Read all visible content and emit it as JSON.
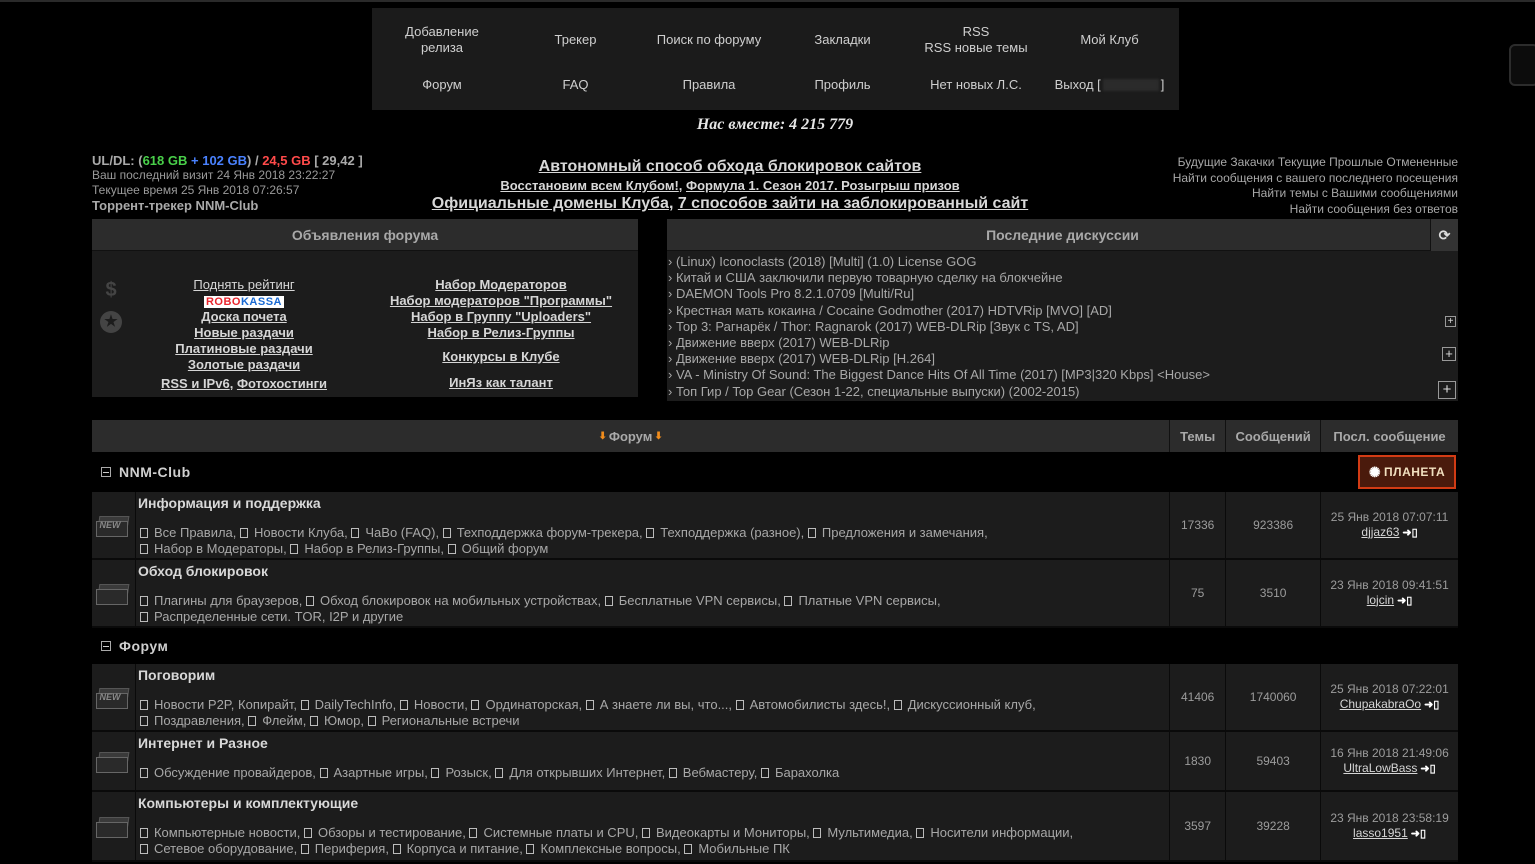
{
  "nav": {
    "row1": [
      "Добавление релиза",
      "Трекер",
      "Поиск по форуму",
      "Закладки",
      "RSS",
      "Мой Клуб"
    ],
    "rss_sub": "RSS новые темы",
    "row2": [
      "Форум",
      "FAQ",
      "Правила",
      "Профиль",
      "Нет новых Л.С.",
      "Выход ["
    ],
    "logout_close": "]"
  },
  "together": "Нас вместе: 4 215 779",
  "user": {
    "uldl_label": "UL/DL:",
    "open_paren": "(",
    "ul": "618 GB",
    "plus": " + ",
    "bonus": "102 GB",
    "slash": ") / ",
    "dl": "24,5 GB",
    "ratio": " [ 29,42 ]",
    "last_visit": "Ваш последний визит 24 Янв 2018 23:22:27",
    "current_time": "Текущее время 25 Янв 2018 07:26:57",
    "tracker_name": "Торрент-трекер NNM-Club"
  },
  "center": {
    "line1": "Автономный способ обхода блокировок сайтов",
    "line2a": "Восстановим всем Клубом!",
    "line2b": "Формула 1. Сезон 2017. Розыгрыш призов",
    "line3a": "Официальные домены Клуба",
    "line3b": "7 способов зайти на заблокированный сайт",
    "comma": ", "
  },
  "right_links": {
    "future": "Будущие Закачки",
    "current": "Текущие",
    "past": "Прошлые",
    "cancelled": "Отмененные",
    "since_last": "Найти сообщения с вашего последнего посещения",
    "your_topics": "Найти темы с Вашими сообщениями",
    "unanswered": "Найти сообщения без ответов"
  },
  "announcements": {
    "title": "Объявления форума",
    "left": {
      "raise_rating": "Поднять рейтинг",
      "robokassa_a": "ROBO",
      "robokassa_b": "KASSA",
      "honor": "Доска почета",
      "new": "Новые раздачи",
      "platinum": "Платиновые раздачи",
      "gold": "Золотые раздачи",
      "rss": "RSS и IPv6",
      "photohost": "Фотохостинги",
      "comma": ", "
    },
    "right": [
      "Набор Модераторов",
      "Набор модераторов \"Программы\"",
      "Набор в Группу \"Uploaders\"",
      "Набор в Релиз-Группы",
      "Конкурсы в Клубе",
      "ИнЯз как талант"
    ],
    "icons": [
      "$",
      "★"
    ]
  },
  "discussions": {
    "title": "Последние дискуссии",
    "items": [
      "› (Linux) Iconoclasts (2018) [Multi] (1.0) License GOG",
      "› Китай и США заключили первую товарную сделку на блокчейне",
      "› DAEMON Tools Pro 8.2.1.0709 [Multi/Ru]",
      "› Крестная мать кокаина / Cocaine Godmother (2017) HDTVRip [MVO] [AD]",
      "› Тор 3: Рагнарёк / Thor: Ragnarok (2017) WEB-DLRip [Звук с TS, AD]",
      "› Движение вверх (2017) WEB-DLRip",
      "› Движение вверх (2017) WEB-DLRip [H.264]",
      "› VA - Ministry Of Sound: The Biggest Dance Hits Of All Time (2017) [MP3|320 Kbps] <House>",
      "› Топ Гир / Top Gear (Сезон 1-22, специальные выпуски) (2002-2015)"
    ],
    "refresh_icon": "⟳",
    "plus": "+"
  },
  "table": {
    "headers": {
      "forum": "Форум",
      "topics": "Темы",
      "messages": "Сообщений",
      "last": "Посл. сообщение"
    },
    "arrow": "⬇",
    "banner": "ПЛАНЕТА",
    "categories": [
      "NNM-Club",
      "Форум"
    ],
    "rows": [
      {
        "title": "Информация и поддержка",
        "new": "NEW",
        "subs": [
          "Все Правила",
          "Новости Клуба",
          "ЧаВо (FAQ)",
          "Техподдержка форум-трекера",
          "Техподдержка (разное)",
          "Предложения и замечания",
          "Набор в Модераторы",
          "Набор в Релиз-Группы",
          "Общий форум"
        ],
        "topics": "17336",
        "messages": "923386",
        "date": "25 Янв 2018 07:07:11",
        "user": "djjaz63"
      },
      {
        "title": "Обход блокировок",
        "subs": [
          "Плагины для браузеров",
          "Обход блокировок на мобильных устройствах",
          "Бесплатные VPN сервисы",
          "Платные VPN сервисы",
          "Распределенные сети. TOR, I2P и другие"
        ],
        "topics": "75",
        "messages": "3510",
        "date": "23 Янв 2018 09:41:51",
        "user": "lojcin"
      },
      {
        "title": "Поговорим",
        "new": "NEW",
        "subs": [
          "Новости P2P, Копирайт",
          "DailyTechInfo",
          "Новости",
          "Ординаторская",
          "А знаете ли вы, что...",
          "Автомобилисты здесь!",
          "Дискуссионный клуб",
          "Поздравления",
          "Флейм",
          "Юмор",
          "Региональные встречи"
        ],
        "topics": "41406",
        "messages": "1740060",
        "date": "25 Янв 2018 07:22:01",
        "user": "ChupakabraOo"
      },
      {
        "title": "Интернет и Разное",
        "subs": [
          "Обсуждение провайдеров",
          "Азартные игры",
          "Розыск",
          "Для открывших Интернет",
          "Вебмастеру",
          "Барахолка"
        ],
        "topics": "1830",
        "messages": "59403",
        "date": "16 Янв 2018 21:49:06",
        "user": "UltraLowBass"
      },
      {
        "title": "Компьютеры и комплектующие",
        "subs": [
          "Компьютерные новости",
          "Обзоры и тестирование",
          "Системные платы и CPU",
          "Видеокарты и Мониторы",
          "Мультимедиа",
          "Носители информации",
          "Сетевое оборудование",
          "Периферия",
          "Корпуса и питание",
          "Комплексные вопросы",
          "Мобильные ПК"
        ],
        "topics": "3597",
        "messages": "39228",
        "date": "23 Янв 2018 23:58:19",
        "user": "lasso1951"
      }
    ],
    "goto_icon": "➜▯"
  }
}
